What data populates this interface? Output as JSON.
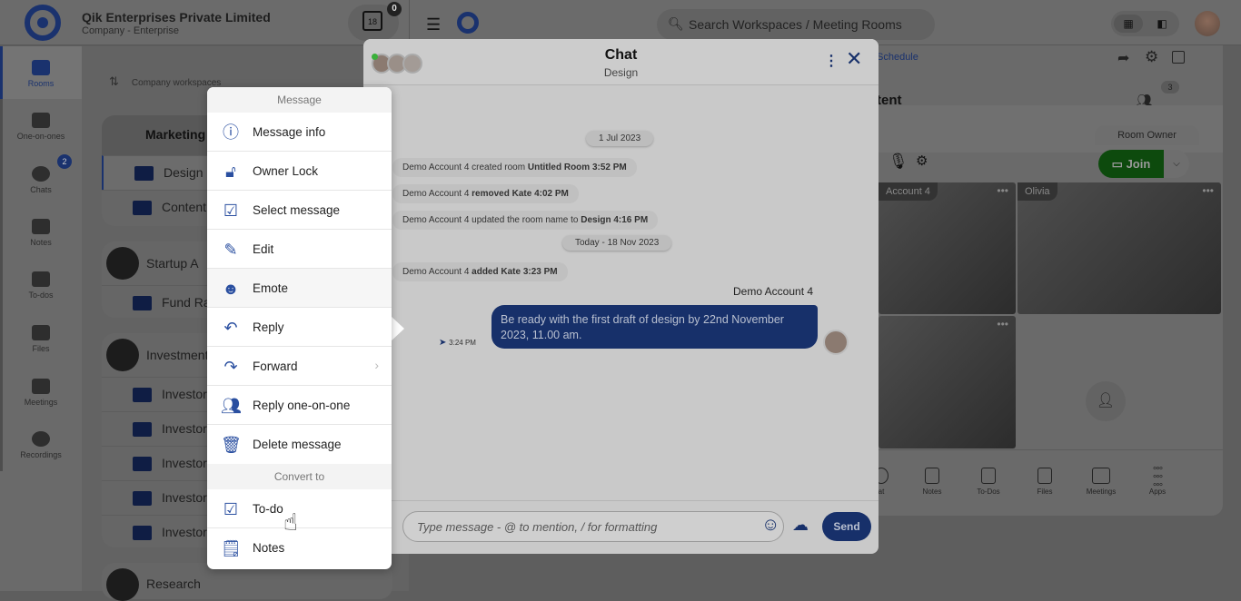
{
  "header": {
    "company": "Qik Enterprises Private Limited",
    "company_sub": "Company - Enterprise",
    "calendar_day": "18",
    "calendar_badge": "0",
    "search_placeholder": "Search Workspaces / Meeting Rooms"
  },
  "nav": {
    "items": [
      {
        "label": "Rooms"
      },
      {
        "label": "One-on-ones"
      },
      {
        "label": "Chats",
        "badge": "2"
      },
      {
        "label": "Notes"
      },
      {
        "label": "To-dos"
      },
      {
        "label": "Files"
      },
      {
        "label": "Meetings"
      },
      {
        "label": "Recordings"
      }
    ]
  },
  "workspaces": {
    "header": "Company workspaces",
    "groups": [
      {
        "name": "Marketing",
        "rooms": [
          "Design",
          "Content"
        ]
      },
      {
        "name": "Startup A",
        "rooms": [
          "Fund Rai"
        ]
      },
      {
        "name": "Investment",
        "rooms": [
          "Investor",
          "Investor",
          "Investor",
          "Investor",
          "Investor"
        ]
      },
      {
        "name": "Research",
        "rooms": []
      }
    ]
  },
  "room_panel": {
    "schedule": "Schedule",
    "title": "tent",
    "participants_count": "3",
    "room_owner": "Room Owner",
    "join": "Join",
    "tiles": [
      "Account 4",
      "Olivia"
    ],
    "bottom": [
      "at",
      "Notes",
      "To-Dos",
      "Files",
      "Meetings",
      "Apps"
    ]
  },
  "chat": {
    "title": "Chat",
    "subtitle": "Design",
    "date1": "1 Jul 2023",
    "date2": "Today - 18 Nov 2023",
    "events": [
      {
        "a": "Demo Account 4 created room ",
        "b": "Untitled Room 3:52 PM"
      },
      {
        "a": "Demo Account 4 ",
        "b": "removed Kate 4:02 PM"
      },
      {
        "a": "Demo Account 4 updated the room name to ",
        "b": "Design 4:16 PM"
      },
      {
        "a": "Demo Account 4 ",
        "b": "added Kate 3:23 PM"
      }
    ],
    "sender": "Demo Account 4",
    "message": "Be ready with the first draft of design by 22nd November 2023, 11.00 am.",
    "time": "3:24 PM",
    "input_placeholder": "Type message - @ to mention, / for formatting",
    "send": "Send"
  },
  "menu": {
    "section1": "Message",
    "items": [
      "Message info",
      "Owner Lock",
      "Select message",
      "Edit",
      "Emote",
      "Reply",
      "Forward",
      "Reply one-on-one",
      "Delete message"
    ],
    "section2": "Convert to",
    "convert": [
      "To-do",
      "Notes"
    ]
  },
  "colors": {
    "brand": "#1a326e",
    "join": "#0d4a0d",
    "accent": "#2a4fa0"
  }
}
